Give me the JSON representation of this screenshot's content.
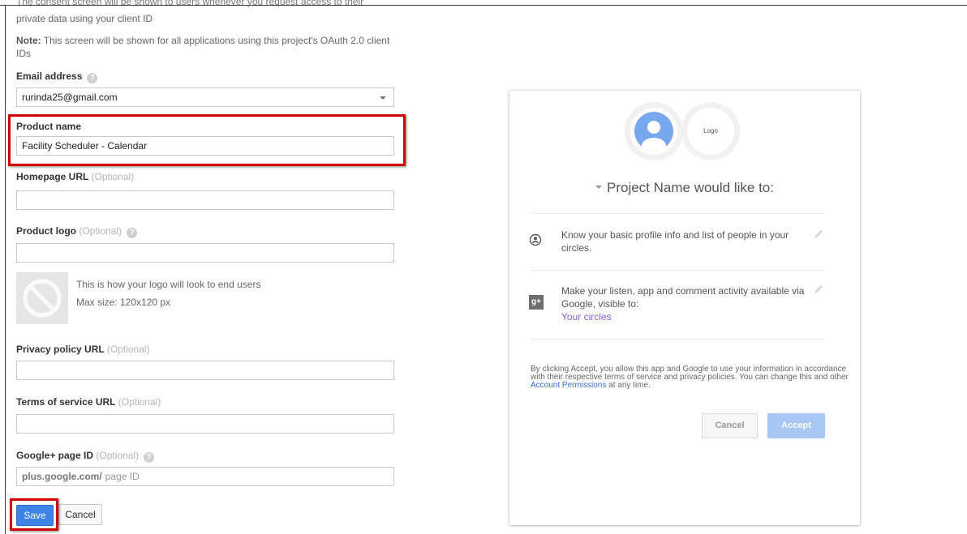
{
  "intro": {
    "line1": "The consent screen will be shown to users whenever you request access to their",
    "line2": "private data using your client ID"
  },
  "note": {
    "label": "Note:",
    "text": " This screen will be shown for all applications using this project's OAuth 2.0 client IDs"
  },
  "form": {
    "email_label": "Email address",
    "email_value": "rurinda25@gmail.com",
    "product_name_label": "Product name",
    "product_name_value": "Facility Scheduler - Calendar",
    "homepage_label": "Homepage URL",
    "optional_text": "(Optional)",
    "product_logo_label": "Product logo",
    "logo_hint_line1": "This is how your logo will look to end users",
    "logo_hint_line2": "Max size: 120x120 px",
    "privacy_label": "Privacy policy URL",
    "terms_label": "Terms of service URL",
    "gplus_label": "Google+ page ID",
    "gplus_prefix": "plus.google.com/",
    "gplus_placeholder": "page ID",
    "help_glyph": "?",
    "save_label": "Save",
    "cancel_label": "Cancel"
  },
  "preview": {
    "logo_text": "Logo",
    "would_like": "Project Name would like to:",
    "perm1": "Know your basic profile info and list of people in your circles.",
    "perm2": "Make your listen, app and comment activity available via Google, visible to:",
    "perm2_link": "Your circles",
    "gplus_icon_text": "g+",
    "legal_before": "By clicking Accept, you allow this app and Google to use your information in accordance with their respective terms of service and privacy policies. You can change this and other ",
    "legal_link": "Account Permissions",
    "legal_after": " at any time.",
    "cancel_label": "Cancel",
    "accept_label": "Accept"
  },
  "colors": {
    "highlight": "#d40000",
    "save_button": "#3d82e6",
    "accept_button": "#a6c6f3",
    "link_purple": "#8d5ed6",
    "avatar_blue": "#79a7ee"
  },
  "icons": [
    "help-icon",
    "dropdown-caret-icon",
    "no-logo-icon",
    "account-circle-icon",
    "google-plus-icon",
    "pencil-icon"
  ]
}
